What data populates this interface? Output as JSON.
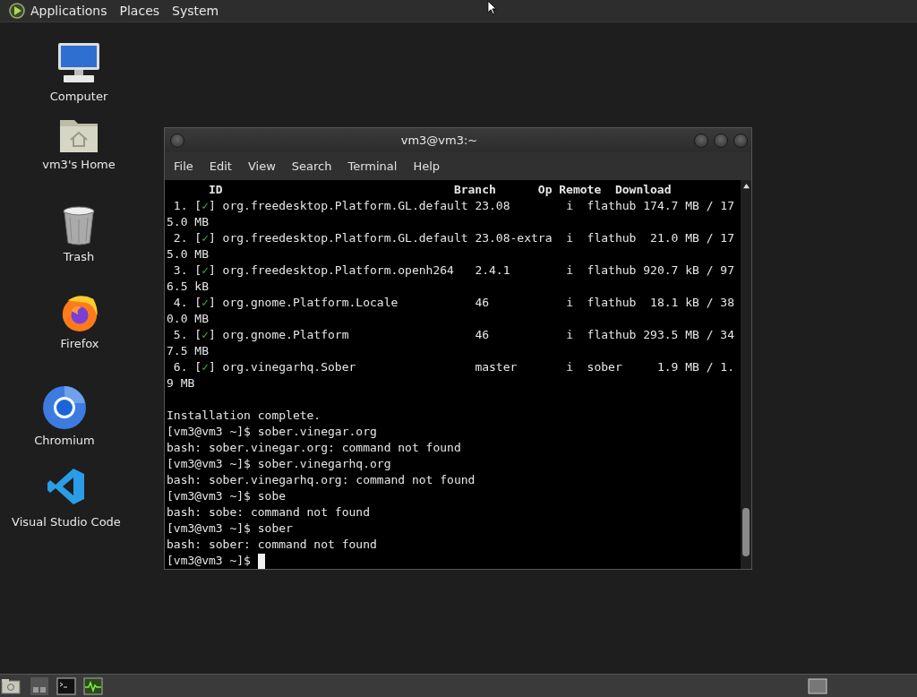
{
  "top_panel": {
    "menus": [
      {
        "label": "Applications"
      },
      {
        "label": "Places"
      },
      {
        "label": "System"
      }
    ]
  },
  "desktop_icons": [
    {
      "kind": "computer",
      "label": "Computer"
    },
    {
      "kind": "home",
      "label": "vm3's Home"
    },
    {
      "kind": "trash",
      "label": "Trash"
    },
    {
      "kind": "firefox",
      "label": "Firefox"
    },
    {
      "kind": "chromium",
      "label": "Chromium"
    },
    {
      "kind": "vscode",
      "label": "Visual Studio Code"
    }
  ],
  "terminal": {
    "title": "vm3@vm3:~",
    "menu": [
      "File",
      "Edit",
      "View",
      "Search",
      "Terminal",
      "Help"
    ],
    "lines": [
      {
        "kind": "header",
        "text": "      ID                                 Branch      Op Remote  Download"
      },
      {
        "kind": "item",
        "before": " 1. [",
        "check": "✓",
        "after": "] org.freedesktop.Platform.GL.default 23.08        i  flathub 174.7 MB / 17"
      },
      {
        "kind": "text",
        "text": "5.0 MB"
      },
      {
        "kind": "item",
        "before": " 2. [",
        "check": "✓",
        "after": "] org.freedesktop.Platform.GL.default 23.08-extra  i  flathub  21.0 MB / 17"
      },
      {
        "kind": "text",
        "text": "5.0 MB"
      },
      {
        "kind": "item",
        "before": " 3. [",
        "check": "✓",
        "after": "] org.freedesktop.Platform.openh264   2.4.1        i  flathub 920.7 kB / 97"
      },
      {
        "kind": "text",
        "text": "6.5 kB"
      },
      {
        "kind": "item",
        "before": " 4. [",
        "check": "✓",
        "after": "] org.gnome.Platform.Locale           46           i  flathub  18.1 kB / 38"
      },
      {
        "kind": "text",
        "text": "0.0 MB"
      },
      {
        "kind": "item",
        "before": " 5. [",
        "check": "✓",
        "after": "] org.gnome.Platform                  46           i  flathub 293.5 MB / 34"
      },
      {
        "kind": "text",
        "text": "7.5 MB"
      },
      {
        "kind": "item",
        "before": " 6. [",
        "check": "✓",
        "after": "] org.vinegarhq.Sober                 master       i  sober     1.9 MB / 1."
      },
      {
        "kind": "text",
        "text": "9 MB"
      },
      {
        "kind": "blank"
      },
      {
        "kind": "text",
        "text": "Installation complete."
      },
      {
        "kind": "text",
        "text": "[vm3@vm3 ~]$ sober.vinegar.org"
      },
      {
        "kind": "text",
        "text": "bash: sober.vinegar.org: command not found"
      },
      {
        "kind": "text",
        "text": "[vm3@vm3 ~]$ sober.vinegarhq.org"
      },
      {
        "kind": "text",
        "text": "bash: sober.vinegarhq.org: command not found"
      },
      {
        "kind": "text",
        "text": "[vm3@vm3 ~]$ sobe"
      },
      {
        "kind": "text",
        "text": "bash: sobe: command not found"
      },
      {
        "kind": "text",
        "text": "[vm3@vm3 ~]$ sober"
      },
      {
        "kind": "text",
        "text": "bash: sober: command not found"
      },
      {
        "kind": "prompt",
        "text": "[vm3@vm3 ~]$ ",
        "cursor": true
      }
    ]
  }
}
